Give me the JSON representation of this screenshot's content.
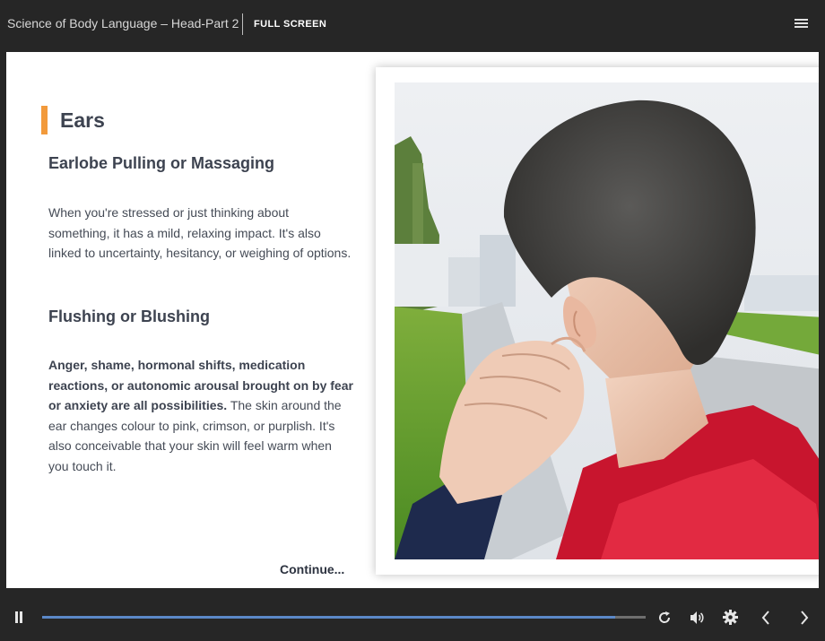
{
  "header": {
    "course_title": "Science of Body Language – Head-Part 2",
    "fullscreen_label": "FULL SCREEN",
    "menu_icon": "hamburger-menu-icon"
  },
  "slide": {
    "heading": "Ears",
    "sections": [
      {
        "subheading": "Earlobe Pulling or Massaging",
        "text": "When you're stressed or just thinking about something, it has a mild, relaxing impact. It's also linked to uncertainty, hesitancy, or weighing of options."
      },
      {
        "subheading": "Flushing or Blushing",
        "bold_text": "Anger, shame, hormonal shifts, medication reactions, or autonomic arousal brought on by fear or anxiety are all possibilities.",
        "text": " The skin around the ear changes colour to pink, crimson, or purplish. It's also conceivable that your skin will feel warm when you touch it."
      }
    ],
    "continue_label": "Continue...",
    "accent_color": "#f29a3b"
  },
  "player": {
    "progress_fraction": 0.95,
    "progress_color": "#5b88c7",
    "icons": [
      "pause-icon",
      "replay-icon",
      "volume-icon",
      "settings-icon",
      "chevron-left-icon",
      "chevron-right-icon"
    ]
  }
}
